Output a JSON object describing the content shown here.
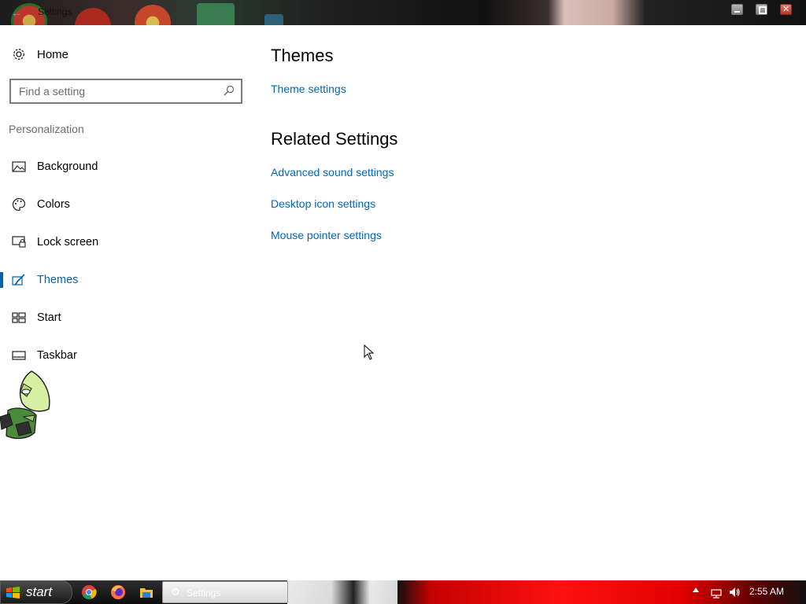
{
  "window": {
    "title": "Settings",
    "back_icon": "back-arrow-icon"
  },
  "sidebar": {
    "home_label": "Home",
    "search_placeholder": "Find a setting",
    "section_label": "Personalization",
    "items": [
      {
        "label": "Background",
        "icon": "picture-icon",
        "active": false
      },
      {
        "label": "Colors",
        "icon": "palette-icon",
        "active": false
      },
      {
        "label": "Lock screen",
        "icon": "lock-screen-icon",
        "active": false
      },
      {
        "label": "Themes",
        "icon": "brush-icon",
        "active": true
      },
      {
        "label": "Start",
        "icon": "start-tiles-icon",
        "active": false
      },
      {
        "label": "Taskbar",
        "icon": "taskbar-icon",
        "active": false
      }
    ]
  },
  "main": {
    "themes_heading": "Themes",
    "theme_settings_link": "Theme settings",
    "related_heading": "Related Settings",
    "related_links": [
      "Advanced sound settings",
      "Desktop icon settings",
      "Mouse pointer settings"
    ]
  },
  "taskbar": {
    "start_label": "start",
    "pinned": [
      "chrome-icon",
      "firefox-icon",
      "file-explorer-icon"
    ],
    "task_label": "Settings",
    "clock": "2:55 AM"
  },
  "colors": {
    "accent": "#0063b1",
    "link": "#0067b8"
  }
}
